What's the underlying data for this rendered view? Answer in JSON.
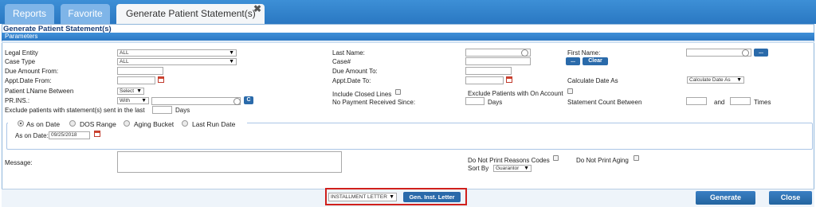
{
  "tabs": [
    {
      "label": "Reports"
    },
    {
      "label": "Favorite"
    },
    {
      "label": "Generate Patient Statement(s)"
    }
  ],
  "tab_close": "✖",
  "page_title": "Generate Patient Statement(s)",
  "section_label": "Parameters",
  "fields": {
    "legal_entity": {
      "label": "Legal Entity",
      "value": "ALL"
    },
    "case_type": {
      "label": "Case Type",
      "value": "ALL"
    },
    "due_amount_from": {
      "label": "Due Amount From:"
    },
    "appt_date_from": {
      "label": "Appt.Date From:"
    },
    "patient_lname_between": {
      "label": "Patient LName Between",
      "value": "Select"
    },
    "pr_ins": {
      "label": "PR.INS.:",
      "value": "With"
    },
    "exclude_sent": {
      "label": "Exclude patients with statement(s) sent in the last",
      "suffix": "Days"
    },
    "last_name": {
      "label": "Last Name:"
    },
    "case_no": {
      "label": "Case#"
    },
    "due_amount_to": {
      "label": "Due Amount To:"
    },
    "appt_date_to": {
      "label": "Appt.Date To:"
    },
    "include_closed_lines": {
      "label": "Include Closed Lines"
    },
    "no_payment_since": {
      "label": "No Payment Received Since:",
      "suffix": "Days"
    },
    "exclude_on_account": {
      "label": "Exclude Patients with On Account"
    },
    "first_name": {
      "label": "First Name:"
    },
    "calculate_date_as": {
      "label": "Calculate Date As",
      "value": "Calculate Date As"
    },
    "statement_count": {
      "label": "Statement Count Between",
      "and": "and",
      "suffix": "Times"
    },
    "message": {
      "label": "Message:"
    },
    "do_not_print_reasons": {
      "label": "Do Not Print Reasons Codes"
    },
    "do_not_print_aging": {
      "label": "Do Not Print Aging"
    },
    "sort_by": {
      "label": "Sort By",
      "value": "Guarantor"
    }
  },
  "buttons": {
    "first_name_lookup": "...",
    "ellipsis": "...",
    "clear": "Clear",
    "pr_ins_c": "C"
  },
  "date_mode": {
    "options": [
      "As on Date",
      "DOS Range",
      "Aging Bucket",
      "Last Run Date"
    ],
    "selected": "As on Date",
    "as_on_label": "As on Date:",
    "as_on_value": "09/25/2018"
  },
  "footer": {
    "letter_select": "INSTALLMENT LETTER",
    "gen_inst_letter": "Gen. Inst. Letter",
    "generate": "Generate",
    "close": "Close"
  },
  "colors": {
    "accent": "#2a78c2",
    "button": "#2a6aaa",
    "highlight": "#d0201c"
  }
}
